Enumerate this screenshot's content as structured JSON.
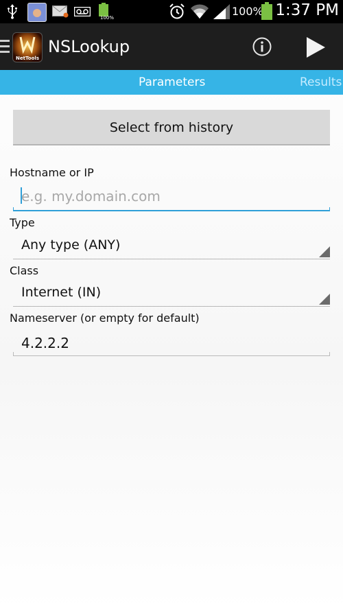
{
  "status_bar": {
    "battery_percent": "100%",
    "battery_small_label": "100%",
    "time": "1:37 PM"
  },
  "action_bar": {
    "title": "NSLookup",
    "app_icon_caption": "NetTools"
  },
  "tabs": {
    "active": "Parameters",
    "inactive": "Results"
  },
  "form": {
    "history_button": "Select from history",
    "hostname_label": "Hostname or IP",
    "hostname_placeholder": "e.g. my.domain.com",
    "type_label": "Type",
    "type_value": "Any type (ANY)",
    "class_label": "Class",
    "class_value": "Internet (IN)",
    "nameserver_label": "Nameserver (or empty for default)",
    "nameserver_value": "4.2.2.2"
  },
  "colors": {
    "accent": "#36b4e6",
    "focus": "#2f9fd8",
    "action_bar": "#1e1e1e"
  }
}
